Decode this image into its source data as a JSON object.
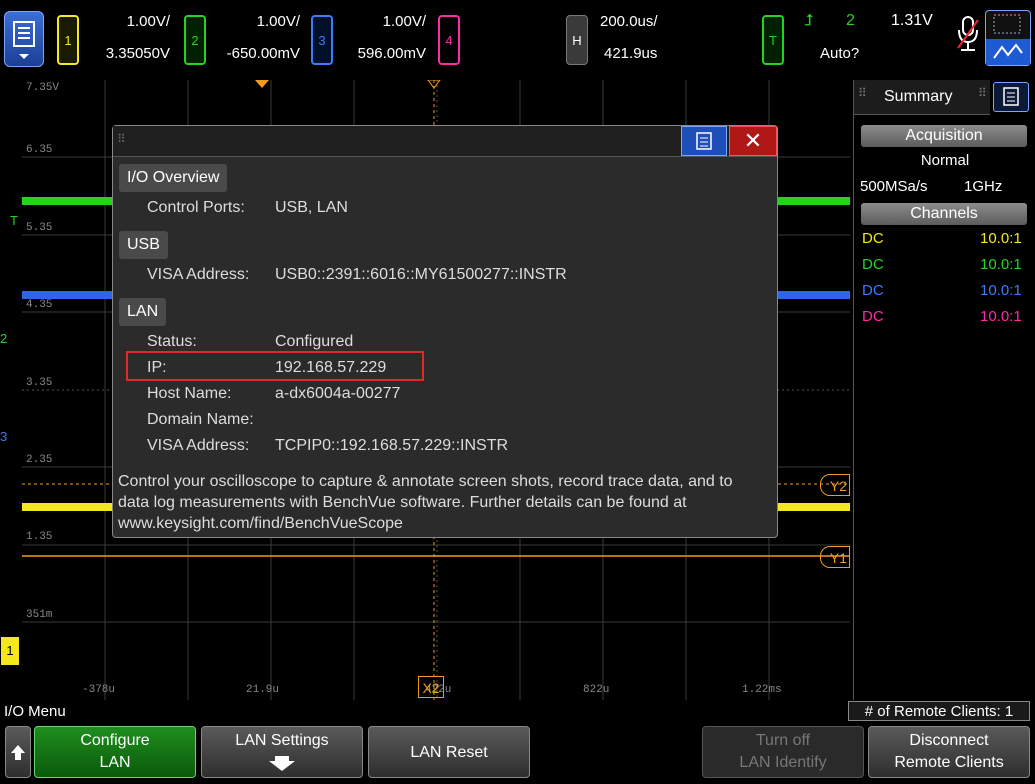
{
  "topbar": {
    "channels": [
      {
        "num": "1",
        "scale": "1.00V/",
        "offset": "3.35050V",
        "color": "#f4e81b"
      },
      {
        "num": "2",
        "scale": "1.00V/",
        "offset": "-650.00mV",
        "color": "#22d322"
      },
      {
        "num": "3",
        "scale": "1.00V/",
        "offset": "596.00mV",
        "color": "#3a7cff"
      },
      {
        "num": "4",
        "scale": "",
        "offset": "",
        "color": "#ff2aa6"
      }
    ],
    "horizontal": {
      "badge": "H",
      "scale": "200.0us/",
      "delay": "421.9us"
    },
    "trigger": {
      "badge": "T",
      "source": "2",
      "level": "1.31V",
      "mode": "Auto?"
    }
  },
  "grid": {
    "y_labels": [
      "7.35V",
      "6.35",
      "5.35",
      "4.35",
      "3.35",
      "2.35",
      "1.35",
      "351m"
    ],
    "x_labels": [
      "-378u",
      "21.9u",
      "422u",
      "822u",
      "1.22ms"
    ],
    "markers": {
      "y1": "Y1",
      "y2": "Y2",
      "x2": "X2",
      "t": "T",
      "ch1": "1",
      "ch2": "2",
      "ch3": "3"
    }
  },
  "side": {
    "tab": "Summary",
    "acq_header": "Acquisition",
    "acq_mode": "Normal",
    "sample_rate": "500MSa/s",
    "bandwidth": "1GHz",
    "ch_header": "Channels",
    "channels": [
      {
        "coupling": "DC",
        "probe": "10.0:1",
        "color": "#f4e81b"
      },
      {
        "coupling": "DC",
        "probe": "10.0:1",
        "color": "#22d322"
      },
      {
        "coupling": "DC",
        "probe": "10.0:1",
        "color": "#3a7cff"
      },
      {
        "coupling": "DC",
        "probe": "10.0:1",
        "color": "#ff2aa6"
      }
    ]
  },
  "dialog": {
    "overview": {
      "title": "I/O Overview",
      "ports_label": "Control Ports:",
      "ports_value": "USB, LAN"
    },
    "usb": {
      "title": "USB",
      "visa_label": "VISA Address:",
      "visa_value": "USB0::2391::6016::MY61500277::INSTR"
    },
    "lan": {
      "title": "LAN",
      "status_label": "Status:",
      "status_value": "Configured",
      "ip_label": "IP:",
      "ip_value": "192.168.57.229",
      "host_label": "Host Name:",
      "host_value": "a-dx6004a-00277",
      "domain_label": "Domain Name:",
      "domain_value": "",
      "visa_label": "VISA Address:",
      "visa_value": "TCPIP0::192.168.57.229::INSTR"
    },
    "footer_line1": "Control your oscilloscope to capture & annotate screen shots, record trace data, and to",
    "footer_line2": "data log measurements with BenchVue software. Further details can be found at",
    "footer_line3": "www.keysight.com/find/BenchVueScope"
  },
  "status": {
    "menu_title": "I/O Menu",
    "remote_clients": "# of Remote Clients: 1"
  },
  "softkeys": {
    "configure_l1": "Configure",
    "configure_l2": "LAN",
    "lan_settings": "LAN Settings",
    "lan_reset": "LAN Reset",
    "turn_off_l1": "Turn off",
    "turn_off_l2": "LAN Identify",
    "disconnect_l1": "Disconnect",
    "disconnect_l2": "Remote Clients"
  }
}
